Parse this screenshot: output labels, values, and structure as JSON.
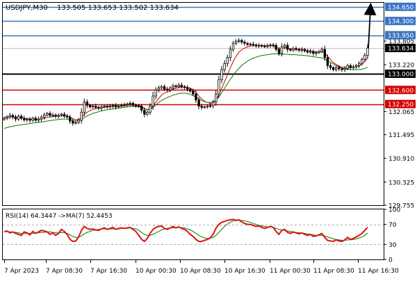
{
  "header": {
    "symbol_timeframe": "USDJPY,M30",
    "ohlc": "133.505 133.653 133.502 133.634"
  },
  "indicator": {
    "label": "RSI(14) 64.3447  ->MA(7) 52.4453",
    "levels": [
      30,
      70
    ],
    "ticks": [
      "100",
      "70",
      "30",
      "0"
    ]
  },
  "price_axis": {
    "ticks": [
      "134.650",
      "134.300",
      "133.950",
      "133.805",
      "133.634",
      "133.220",
      "133.000",
      "132.600",
      "132.250",
      "132.065",
      "131.495",
      "130.910",
      "130.325",
      "129.755"
    ],
    "current_price": "133.634"
  },
  "time_axis": {
    "labels": [
      "7 Apr 2023",
      "7 Apr 08:30",
      "7 Apr 16:30",
      "10 Apr 00:30",
      "10 Apr 08:30",
      "10 Apr 16:30",
      "11 Apr 00:30",
      "11 Apr 08:30",
      "11 Apr 16:30"
    ]
  },
  "colors": {
    "candle": "#000000",
    "ma_fast": "#d40000",
    "ma_slow": "#007a00",
    "resistance": "#3b74c4",
    "support": "#d40000",
    "pivot": "#000000",
    "current_tag": "#000000",
    "rsi": "#e01010",
    "rsi_ma": "#007a00"
  },
  "chart_data": {
    "type": "candlestick",
    "symbol": "USDJPY",
    "timeframe": "M30",
    "ylim": [
      129.755,
      134.75
    ],
    "levels": [
      {
        "value": 134.65,
        "label": "134.650",
        "role": "resistance"
      },
      {
        "value": 134.3,
        "label": "134.300",
        "role": "resistance"
      },
      {
        "value": 133.95,
        "label": "133.950",
        "role": "resistance"
      },
      {
        "value": 133.0,
        "label": "133.000",
        "role": "pivot"
      },
      {
        "value": 132.6,
        "label": "132.600",
        "role": "support"
      },
      {
        "value": 132.25,
        "label": "132.250",
        "role": "support"
      }
    ],
    "close": [
      131.9,
      131.93,
      131.97,
      131.93,
      131.88,
      131.95,
      131.9,
      131.86,
      131.88,
      131.85,
      131.9,
      131.85,
      131.88,
      131.93,
      131.98,
      132.02,
      131.97,
      131.98,
      131.95,
      131.97,
      132.0,
      131.95,
      131.93,
      131.83,
      131.78,
      131.8,
      131.85,
      132.05,
      132.3,
      132.22,
      132.18,
      132.2,
      132.17,
      132.15,
      132.18,
      132.2,
      132.18,
      132.2,
      132.22,
      132.18,
      132.2,
      132.22,
      132.23,
      132.25,
      132.27,
      132.22,
      132.2,
      132.2,
      132.1,
      132.0,
      132.05,
      132.2,
      132.45,
      132.6,
      132.65,
      132.68,
      132.62,
      132.6,
      132.65,
      132.7,
      132.68,
      132.72,
      132.68,
      132.66,
      132.62,
      132.57,
      132.5,
      132.35,
      132.2,
      132.17,
      132.18,
      132.2,
      132.21,
      132.3,
      132.5,
      132.85,
      133.1,
      133.25,
      133.4,
      133.6,
      133.75,
      133.8,
      133.82,
      133.78,
      133.75,
      133.72,
      133.73,
      133.71,
      133.69,
      133.7,
      133.68,
      133.67,
      133.69,
      133.71,
      133.7,
      133.6,
      133.5,
      133.66,
      133.7,
      133.6,
      133.58,
      133.62,
      133.6,
      133.58,
      133.6,
      133.56,
      133.53,
      133.55,
      133.5,
      133.52,
      133.55,
      133.6,
      133.4,
      133.2,
      133.15,
      133.1,
      133.15,
      133.12,
      133.1,
      133.13,
      133.2,
      133.15,
      133.17,
      133.2,
      133.25,
      133.35,
      133.45,
      133.634
    ],
    "series": [
      {
        "name": "MA fast",
        "color": "#d40000",
        "values": [
          131.93,
          131.93,
          131.95,
          131.94,
          131.93,
          131.92,
          131.91,
          131.9,
          131.89,
          131.88,
          131.88,
          131.88,
          131.88,
          131.89,
          131.9,
          131.92,
          131.93,
          131.94,
          131.95,
          131.96,
          131.97,
          131.96,
          131.96,
          131.93,
          131.89,
          131.87,
          131.87,
          131.91,
          132.0,
          132.05,
          132.09,
          132.12,
          132.14,
          132.15,
          132.16,
          132.17,
          132.18,
          132.19,
          132.19,
          132.19,
          132.2,
          132.2,
          132.21,
          132.22,
          132.23,
          132.23,
          132.22,
          132.22,
          132.19,
          132.14,
          132.11,
          132.12,
          132.2,
          132.3,
          132.39,
          132.47,
          132.52,
          132.55,
          132.58,
          132.62,
          132.64,
          132.66,
          132.67,
          132.67,
          132.66,
          132.64,
          132.61,
          132.54,
          132.45,
          132.38,
          132.32,
          132.29,
          132.27,
          132.28,
          132.34,
          132.48,
          132.64,
          132.8,
          132.97,
          133.14,
          133.3,
          133.43,
          133.53,
          133.59,
          133.63,
          133.66,
          133.68,
          133.69,
          133.69,
          133.7,
          133.69,
          133.69,
          133.69,
          133.69,
          133.69,
          133.66,
          133.61,
          133.62,
          133.64,
          133.63,
          133.61,
          133.61,
          133.6,
          133.6,
          133.6,
          133.59,
          133.57,
          133.56,
          133.54,
          133.53,
          133.53,
          133.55,
          133.51,
          133.43,
          133.35,
          133.27,
          133.23,
          133.19,
          133.16,
          133.15,
          133.16,
          133.16,
          133.16,
          133.17,
          133.19,
          133.24,
          133.3,
          133.4
        ]
      },
      {
        "name": "MA slow",
        "color": "#007a00",
        "values": [
          131.65,
          131.67,
          131.69,
          131.7,
          131.72,
          131.73,
          131.74,
          131.75,
          131.76,
          131.77,
          131.78,
          131.79,
          131.8,
          131.81,
          131.82,
          131.83,
          131.84,
          131.85,
          131.86,
          131.87,
          131.88,
          131.88,
          131.88,
          131.87,
          131.85,
          131.84,
          131.84,
          131.87,
          131.92,
          131.96,
          131.99,
          132.02,
          132.04,
          132.06,
          132.08,
          132.1,
          132.11,
          132.12,
          132.13,
          132.14,
          132.15,
          132.16,
          132.17,
          132.18,
          132.19,
          132.19,
          132.19,
          132.19,
          132.17,
          132.14,
          132.12,
          132.13,
          132.17,
          132.23,
          132.29,
          132.34,
          132.38,
          132.41,
          132.44,
          132.47,
          132.49,
          132.51,
          132.52,
          132.52,
          132.51,
          132.49,
          132.46,
          132.42,
          132.38,
          132.34,
          132.31,
          132.29,
          132.29,
          132.3,
          132.35,
          132.43,
          132.53,
          132.64,
          132.75,
          132.86,
          132.96,
          133.05,
          133.13,
          133.2,
          133.26,
          133.31,
          133.35,
          133.38,
          133.41,
          133.43,
          133.45,
          133.46,
          133.47,
          133.48,
          133.49,
          133.49,
          133.48,
          133.48,
          133.48,
          133.48,
          133.47,
          133.47,
          133.47,
          133.46,
          133.46,
          133.45,
          133.44,
          133.43,
          133.42,
          133.41,
          133.4,
          133.39,
          133.36,
          133.32,
          133.28,
          133.24,
          133.2,
          133.17,
          133.14,
          133.12,
          133.11,
          133.1,
          133.1,
          133.1,
          133.1,
          133.11,
          133.13,
          133.16
        ]
      }
    ],
    "forecast_arrow": {
      "from": 133.634,
      "to": 134.65
    },
    "rsi": {
      "ylim": [
        0,
        100
      ],
      "value": 64.3447,
      "ma_value": 52.4453,
      "values": [
        55,
        57,
        53,
        55,
        52,
        50,
        48,
        55,
        53,
        49,
        56,
        52,
        55,
        58,
        57,
        55,
        50,
        53,
        48,
        52,
        60,
        56,
        50,
        40,
        36,
        37,
        45,
        58,
        66,
        62,
        60,
        61,
        59,
        58,
        61,
        63,
        60,
        62,
        64,
        60,
        62,
        63,
        62,
        63,
        64,
        60,
        56,
        48,
        40,
        36,
        42,
        52,
        60,
        64,
        66,
        67,
        62,
        60,
        63,
        66,
        63,
        65,
        62,
        60,
        56,
        50,
        46,
        40,
        36,
        36,
        38,
        40,
        43,
        50,
        62,
        70,
        74,
        76,
        78,
        79,
        80,
        78,
        79,
        75,
        72,
        70,
        70,
        68,
        66,
        67,
        64,
        62,
        64,
        66,
        64,
        56,
        50,
        58,
        60,
        54,
        52,
        55,
        53,
        51,
        53,
        50,
        48,
        50,
        46,
        47,
        49,
        52,
        44,
        38,
        37,
        36,
        39,
        37,
        36,
        39,
        44,
        40,
        42,
        45,
        48,
        52,
        58,
        64.34
      ],
      "ma_values": [
        56,
        56,
        55,
        55,
        54,
        53,
        52,
        52,
        52,
        52,
        52,
        53,
        53,
        54,
        54,
        55,
        55,
        54,
        53,
        53,
        54,
        53,
        52,
        49,
        46,
        44,
        44,
        47,
        51,
        54,
        56,
        58,
        59,
        60,
        61,
        61,
        61,
        61,
        61,
        61,
        61,
        62,
        62,
        62,
        63,
        62,
        61,
        58,
        54,
        50,
        48,
        48,
        50,
        53,
        56,
        59,
        61,
        62,
        63,
        63,
        63,
        64,
        63,
        63,
        61,
        59,
        56,
        52,
        48,
        45,
        43,
        42,
        42,
        44,
        48,
        54,
        60,
        66,
        71,
        74,
        77,
        78,
        78,
        78,
        77,
        76,
        74,
        72,
        70,
        68,
        67,
        66,
        65,
        65,
        64,
        62,
        60,
        59,
        58,
        57,
        56,
        55,
        54,
        53,
        53,
        52,
        51,
        50,
        49,
        48,
        48,
        48,
        47,
        45,
        43,
        41,
        40,
        39,
        38,
        38,
        39,
        39,
        40,
        41,
        43,
        45,
        48,
        52.45
      ]
    }
  }
}
